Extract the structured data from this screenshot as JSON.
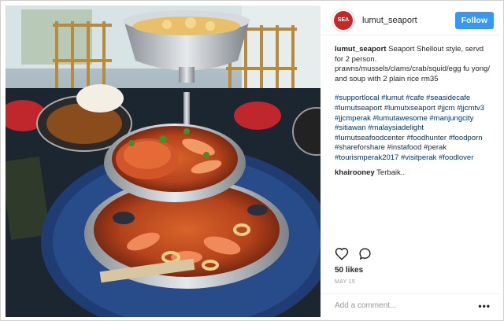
{
  "post": {
    "username": "lumut_seaport",
    "follow_label": "Follow",
    "avatar_icon": "restaurant-logo",
    "caption_user": "lumut_seaport",
    "caption_text": "Seaport Shellout style, servd for 2 person. prawns/mussels/clams/crab/squid/egg fu yong/ and soup with 2 plain rice rm35",
    "hashtags": "#supportlocal #lumut #cafe #seasidecafe #lumutseaport #lumutxseaport #jjcm #jjcmtv3 #jjcmperak #lumutawesome #manjungcity #sitiawan #malaysiadelight #lumutseafoodcenter #foodhunter #foodporn #shareforshare #instafood #perak #tourismperak2017 #visitperak #foodlover",
    "comment_user": "khairooney",
    "comment_text": "Terbaik..",
    "likes": "50 likes",
    "date": "MAY 15",
    "add_comment_placeholder": "Add a comment...",
    "more_label": "•••",
    "icons": {
      "like": "heart-icon",
      "comment": "speech-bubble-icon",
      "more": "more-options-icon"
    }
  },
  "colors": {
    "follow_blue": "#3897f0",
    "hashtag": "#003569",
    "date_gray": "#999999"
  }
}
